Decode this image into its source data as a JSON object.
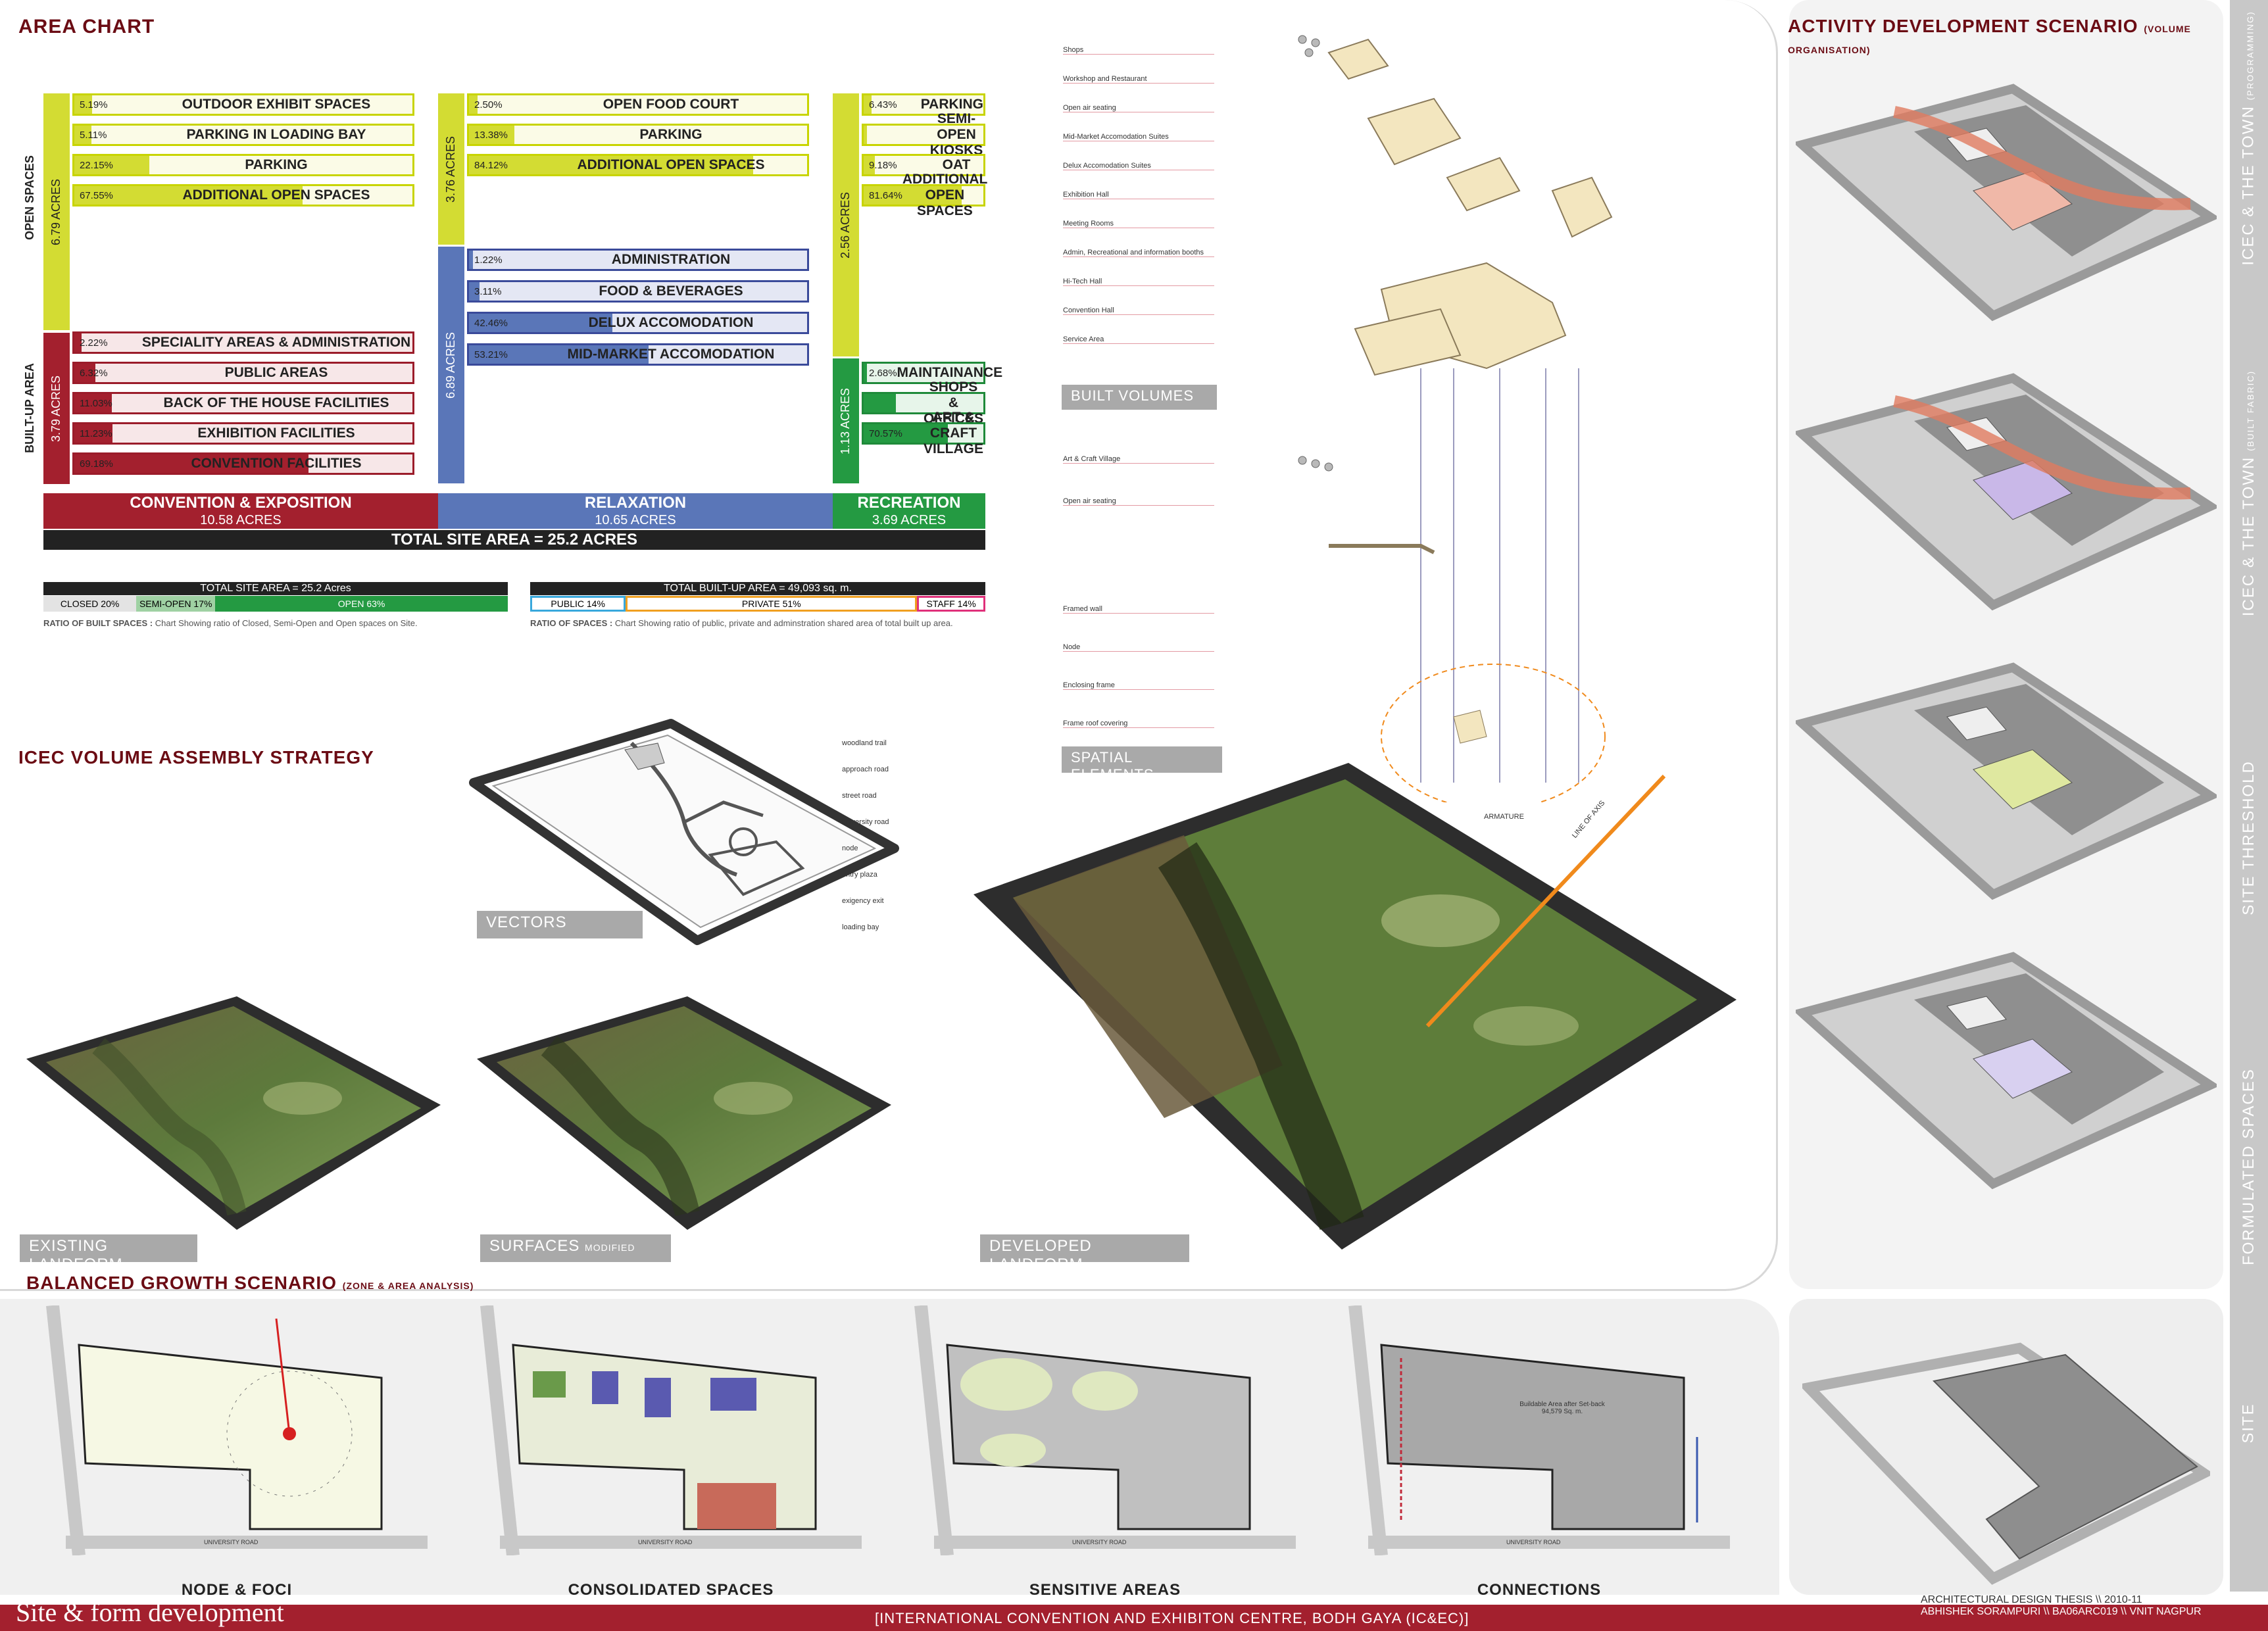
{
  "colors": {
    "maroon": "#6b0c14",
    "yellow": "#d3dc33",
    "red": "#a3202e",
    "blue": "#5a76b8",
    "green": "#249a42"
  },
  "area_chart": {
    "title": "AREA CHART",
    "left_band": {
      "open_label": "OPEN SPACES",
      "open_acres": "6.79 ACRES",
      "built_label": "BUILT-UP AREA",
      "built_acres": "3.79 ACRES"
    },
    "mid_band": {
      "open_acres": "3.76 ACRES",
      "built_acres": "6.89 ACRES"
    },
    "right_band": {
      "open_acres": "2.56 ACRES",
      "built_acres": "1.13 ACRES"
    },
    "convention_open": [
      {
        "pct": "5.19%",
        "label": "OUTDOOR EXHIBIT SPACES",
        "fill": 5.19
      },
      {
        "pct": "5.11%",
        "label": "PARKING IN LOADING BAY",
        "fill": 5.11
      },
      {
        "pct": "22.15%",
        "label": "PARKING",
        "fill": 22.15
      },
      {
        "pct": "67.55%",
        "label": "ADDITIONAL OPEN SPACES",
        "fill": 67.55
      }
    ],
    "convention_built": [
      {
        "pct": "2.22%",
        "label": "SPECIALITY AREAS & ADMINISTRATION",
        "fill": 2.22
      },
      {
        "pct": "6.32%",
        "label": "PUBLIC AREAS",
        "fill": 6.32
      },
      {
        "pct": "11.03%",
        "label": "BACK OF THE HOUSE FACILITIES",
        "fill": 11.03
      },
      {
        "pct": "11.23%",
        "label": "EXHIBITION FACILITIES",
        "fill": 11.23
      },
      {
        "pct": "69.18%",
        "label": "CONVENTION FACILITIES",
        "fill": 69.18
      }
    ],
    "relax_open": [
      {
        "pct": "2.50%",
        "label": "OPEN FOOD COURT",
        "fill": 2.5
      },
      {
        "pct": "13.38%",
        "label": "PARKING",
        "fill": 13.38
      },
      {
        "pct": "84.12%",
        "label": "ADDITIONAL OPEN SPACES",
        "fill": 84.12
      }
    ],
    "relax_built": [
      {
        "pct": "1.22%",
        "label": "ADMINISTRATION",
        "fill": 1.22
      },
      {
        "pct": "3.11%",
        "label": "FOOD & BEVERAGES",
        "fill": 3.11
      },
      {
        "pct": "42.46%",
        "label": "DELUX ACCOMODATION",
        "fill": 42.46
      },
      {
        "pct": "53.21%",
        "label": "MID-MARKET ACCOMODATION",
        "fill": 53.21
      }
    ],
    "rec_open": [
      {
        "pct": "6.43%",
        "label": "PARKING",
        "fill": 6.43
      },
      {
        "pct": "",
        "label": "SEMI-OPEN KIOSKS",
        "fill": 2.75
      },
      {
        "pct": "9.18%",
        "label": "OAT",
        "fill": 9.18
      },
      {
        "pct": "81.64%",
        "label": "ADDITIONAL OPEN SPACES",
        "fill": 81.64
      }
    ],
    "rec_built": [
      {
        "pct": "2.68%",
        "label": "MAINTAINANCE",
        "fill": 2.68
      },
      {
        "pct": "",
        "label": "SHOPS & OFFICES",
        "fill": 26.75
      },
      {
        "pct": "70.57%",
        "label": "ART & CRAFT VILLAGE",
        "fill": 70.57
      }
    ],
    "zones": [
      {
        "name": "CONVENTION & EXPOSITION",
        "acres": "10.58 ACRES"
      },
      {
        "name": "RELAXATION",
        "acres": "10.65 ACRES"
      },
      {
        "name": "RECREATION",
        "acres": "3.69 ACRES"
      }
    ],
    "total": "TOTAL SITE AREA = 25.2 ACRES",
    "ratio1": {
      "header": "TOTAL SITE AREA = 25.2 Acres",
      "closed": "CLOSED 20%",
      "semi": "SEMI-OPEN 17%",
      "open": "OPEN 63%",
      "closed_pct": 20,
      "semi_pct": 17,
      "open_pct": 63,
      "note_bold": "RATIO OF BUILT SPACES :",
      "note": "Chart Showing ratio of Closed, Semi-Open and Open spaces on Site."
    },
    "ratio2": {
      "header": "TOTAL BUILT-UP AREA = 49,093 sq. m.",
      "public": "PUBLIC 14%",
      "private": "PRIVATE 51%",
      "staff": "STAFF 14%",
      "note_bold": "RATIO OF SPACES :",
      "note": "Chart Showing ratio of public, private and adminstration shared area of total built up area."
    }
  },
  "assembly": {
    "title": "ICEC  VOLUME  ASSEMBLY  STRATEGY",
    "vectors_label": "VECTORS",
    "vector_callouts": [
      "woodland trail",
      "approach road",
      "street road",
      "university road",
      "node",
      "entry plaza",
      "exigency exit",
      "loading bay"
    ],
    "existing": "EXISTING  LANDFORM",
    "surfaces": "SURFACES",
    "surfaces_small": "MODIFIED LANDFORM",
    "developed": "DEVELOPED  LANDFORM"
  },
  "exploded": {
    "built_volumes": "BUILT VOLUMES",
    "spatial_elements": "SPATIAL ELEMENTS",
    "armature": "ARMATURE",
    "line_of_axis": "LINE OF AXIS",
    "callouts_top": [
      "Shops",
      "Workshop and Restaurant",
      "Open air seating",
      "Mid-Market Accomodation Suites",
      "Delux Accomodation Suites",
      "Exhibition Hall",
      "Meeting Rooms",
      "Admin, Recreational and information booths",
      "Hi-Tech Hall",
      "Convention Hall",
      "Service Area"
    ],
    "callouts_mid": [
      "Art & Craft Village",
      "Open air seating"
    ],
    "callouts_low": [
      "Framed wall",
      "Node",
      "Enclosing frame",
      "Frame roof covering"
    ]
  },
  "activity": {
    "title": "ACTIVITY  DEVELOPMENT  SCENARIO",
    "title_small": "(VOLUME ORGANISATION)",
    "tabs": [
      {
        "label": "ICEC  &  THE TOWN",
        "small": "(PROGRAMMING)"
      },
      {
        "label": "ICEC  &  THE TOWN",
        "small": "(BUILT FABRIC)"
      },
      {
        "label": "SITE THRESHOLD",
        "small": ""
      },
      {
        "label": "FORMULATED SPACES",
        "small": ""
      },
      {
        "label": "SITE",
        "small": ""
      }
    ]
  },
  "growth": {
    "title": "BALANCED  GROWTH  SCENARIO",
    "title_small": "(ZONE & AREA ANALYSIS)",
    "panels": [
      "NODE  &  FOCI",
      "CONSOLIDATED  SPACES",
      "SENSITIVE  AREAS",
      "CONNECTIONS"
    ],
    "road_label": "UNIVERSITY ROAD",
    "buildable": "Buildable Area after Set-back 94,579 Sq. m."
  },
  "footer": {
    "left": "Site & form development",
    "center": "[INTERNATIONAL CONVENTION AND EXHIBITON CENTRE, BODH GAYA (IC&EC)]",
    "right1": "ARCHITECTURAL DESIGN THESIS \\\\ 2010-11",
    "right2": "ABHISHEK SORAMPURI \\\\ BA06ARC019 \\\\ VNIT NAGPUR"
  }
}
